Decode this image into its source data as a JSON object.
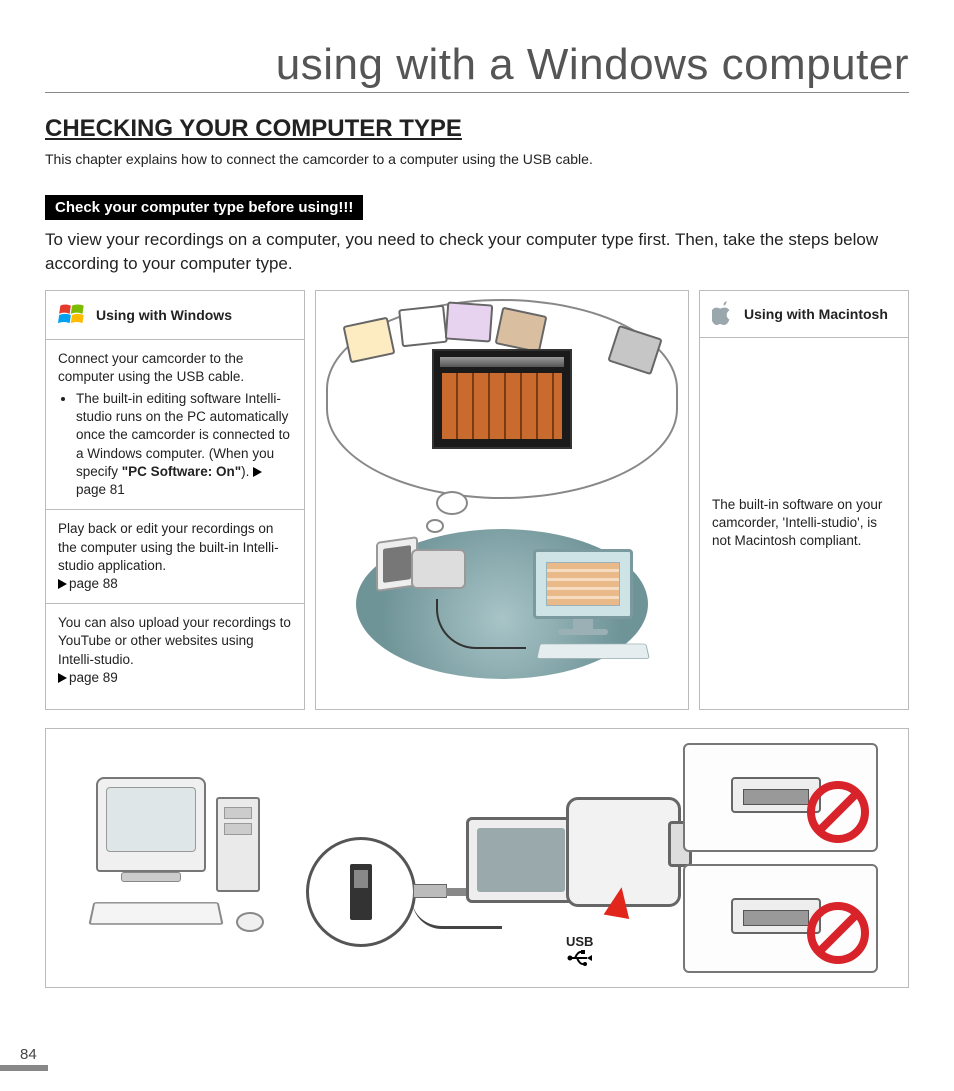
{
  "page_title": "using with a Windows computer",
  "section_heading": "CHECKING YOUR COMPUTER TYPE",
  "intro": "This chapter explains how to connect the camcorder to a computer using the USB cable.",
  "banner": "Check your computer type before using!!!",
  "banner_followup": "To view your recordings on a computer, you need to check your computer type first. Then, take the steps below according to your computer type.",
  "windows": {
    "title": "Using with Windows",
    "block1_lead": "Connect your camcorder to the computer using the USB cable.",
    "block1_bullet_pre": "The built-in editing software Intelli-studio runs on the PC automatically once the camcorder is connected to a Windows computer. (When you specify ",
    "block1_bullet_bold": "\"PC Software: On\"",
    "block1_bullet_post": "). ",
    "block1_pageref": "page 81",
    "block2_text": "Play back or edit your recordings on the computer using the built-in Intelli-studio application.",
    "block2_pageref": "page 88",
    "block3_text": "You can also upload your recordings to YouTube or other websites using Intelli-studio.",
    "block3_pageref": "page 89"
  },
  "mac": {
    "title": "Using with Macintosh",
    "body": "The built-in software on your camcorder, 'Intelli-studio', is not Macintosh compliant."
  },
  "usb_label": "USB",
  "page_number": "84"
}
